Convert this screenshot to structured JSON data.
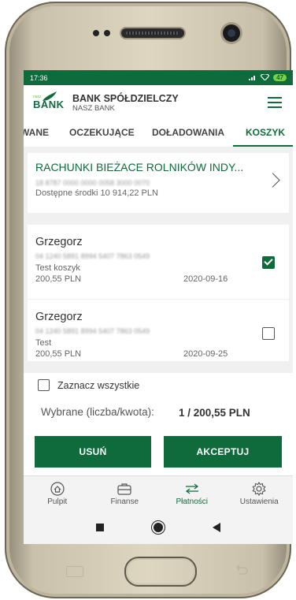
{
  "status": {
    "time": "17:36",
    "battery": "47"
  },
  "header": {
    "logo_small": "nasz",
    "logo_main": "BANK",
    "title": "BANK SPÓŁDZIELCZY",
    "subtitle": "NASZ BANK"
  },
  "tabs": [
    {
      "label": "WANE"
    },
    {
      "label": "OCZEKUJĄCE"
    },
    {
      "label": "DOŁADOWANIA"
    },
    {
      "label": "KOSZYK",
      "active": true
    }
  ],
  "account": {
    "name": "RACHUNKI BIEŻACE ROLNIKÓW INDY...",
    "number": "18 8787 0000 0000 0058 3000 0070",
    "balance": "Dostępne środki 10 914,22 PLN"
  },
  "transfers": [
    {
      "name": "Grzegorz",
      "account": "04 1240 5891 8994 5407 7863 0549",
      "title": "Test koszyk",
      "amount": "200,55 PLN",
      "date": "2020-09-16",
      "checked": true
    },
    {
      "name": "Grzegorz",
      "account": "04 1240 5891 8994 5407 7863 0549",
      "title": "Test",
      "amount": "200,55 PLN",
      "date": "2020-09-25",
      "checked": false
    }
  ],
  "select_all": "Zaznacz wszystkie",
  "summary": {
    "label": "Wybrane (liczba/kwota):",
    "value": "1 / 200,55 PLN"
  },
  "buttons": {
    "delete": "USUŃ",
    "accept": "AKCEPTUJ"
  },
  "bottom_nav": [
    {
      "label": "Pulpit",
      "icon": "home-icon"
    },
    {
      "label": "Finanse",
      "icon": "wallet-icon"
    },
    {
      "label": "Płatności",
      "icon": "transfer-arrows-icon",
      "active": true
    },
    {
      "label": "Ustawienia",
      "icon": "gear-icon"
    }
  ],
  "colors": {
    "brand": "#0f6b3c",
    "accent": "#7bc043"
  }
}
